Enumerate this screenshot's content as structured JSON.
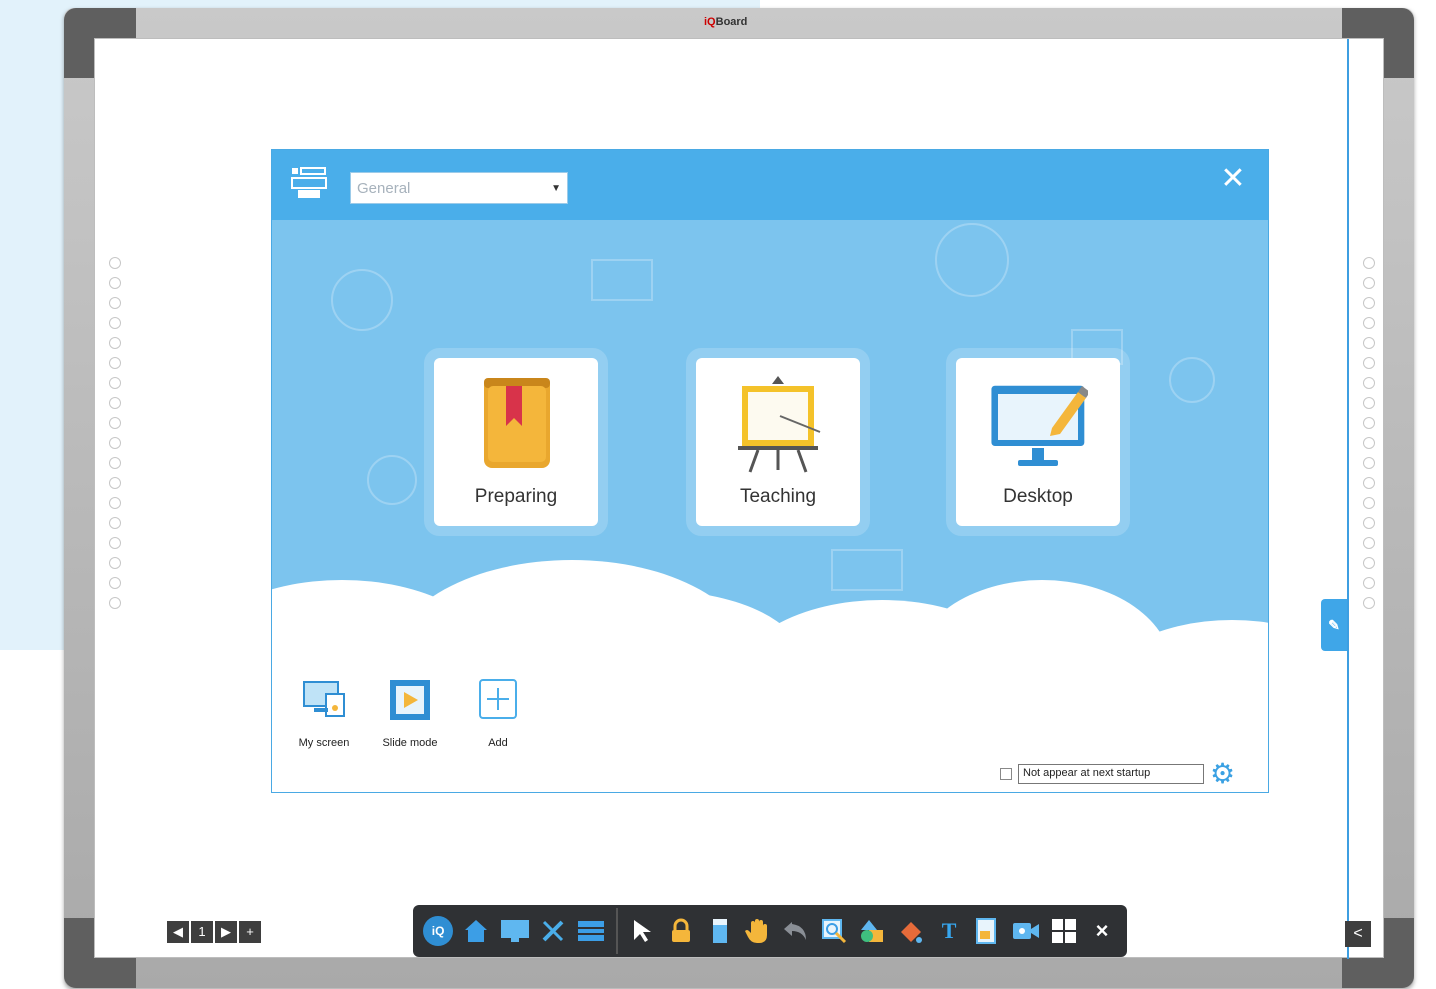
{
  "board": {
    "brand_primary": "iQ",
    "brand_secondary": "Board"
  },
  "dialog": {
    "mode_select_value": "General",
    "close_icon": "close-icon",
    "tiles": [
      {
        "label": "Preparing",
        "icon": "book-icon"
      },
      {
        "label": "Teaching",
        "icon": "easel-icon"
      },
      {
        "label": "Desktop",
        "icon": "monitor-pencil-icon"
      }
    ],
    "shortcuts": [
      {
        "label": "My screen",
        "icon": "screen-share-icon"
      },
      {
        "label": "Slide mode",
        "icon": "slide-play-icon"
      },
      {
        "label": "Add",
        "icon": "add-icon"
      }
    ],
    "startup_option": {
      "checked": false,
      "label": "Not appear at next startup"
    }
  },
  "pager": {
    "prev": "◀",
    "page": "1",
    "next": "▶",
    "add": "+"
  },
  "collapse": "<",
  "side_tab_icon": "pen-tab-icon",
  "toolbar": {
    "logo_text": "iQ",
    "text_tool": "T",
    "close_label": "×",
    "items": [
      "home-icon",
      "screen-icon",
      "tools-icon",
      "panel-icon",
      "select-arrow-icon",
      "lock-icon",
      "eraser-icon",
      "hand-icon",
      "undo-icon",
      "zoom-icon",
      "shape-icon",
      "fill-icon",
      "text-icon",
      "doc-icon",
      "record-icon",
      "grid-icon",
      "close-icon"
    ]
  },
  "colors": {
    "accent": "#4aaeea",
    "sky": "#7cc4ee",
    "toolbar_bg": "#2f3134",
    "frame": "#a9a9a9"
  }
}
